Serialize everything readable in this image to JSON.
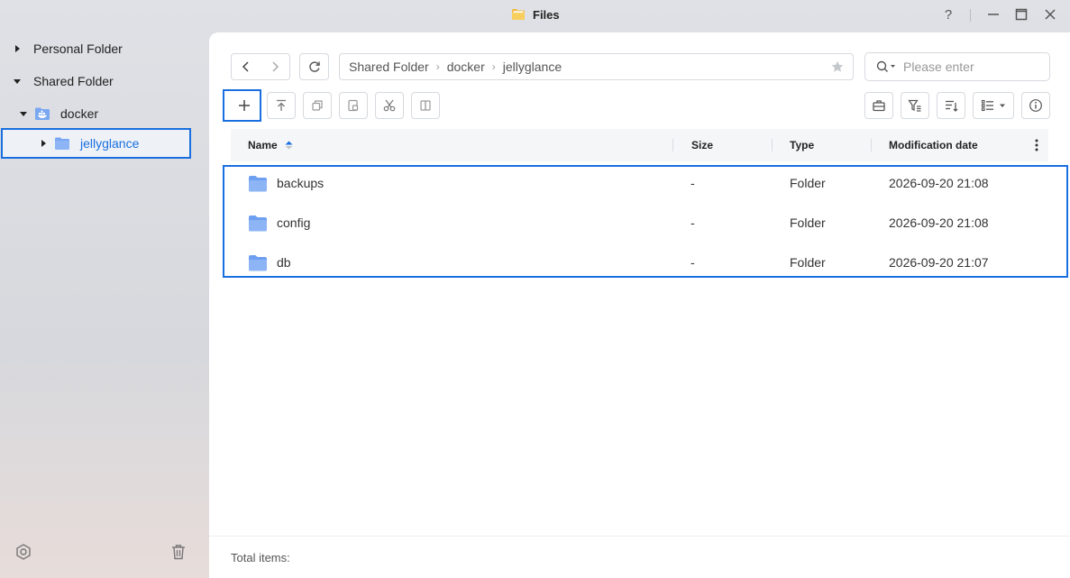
{
  "window": {
    "title": "Files",
    "icon": "folder-app-icon",
    "controls": [
      "help-icon",
      "minimize-icon",
      "maximize-icon",
      "close-icon"
    ],
    "help_label": "?"
  },
  "sidebar": {
    "items": [
      {
        "label": "Personal Folder",
        "expanded": false
      },
      {
        "label": "Shared Folder",
        "expanded": true
      },
      {
        "label": "docker",
        "expanded": true,
        "icon": "docker-folder-icon"
      },
      {
        "label": "jellyglance",
        "expanded": false,
        "selected": true,
        "icon": "folder-icon"
      }
    ],
    "bottom_icons": [
      "settings-icon",
      "trash-icon"
    ]
  },
  "toolbar": {
    "breadcrumb": [
      "Shared Folder",
      "docker",
      "jellyglance"
    ],
    "search_placeholder": "Please enter"
  },
  "table": {
    "columns": {
      "name": "Name",
      "size": "Size",
      "type": "Type",
      "modified": "Modification date"
    },
    "sort": {
      "column": "name",
      "direction": "asc"
    },
    "rows": [
      {
        "name": "backups",
        "size": "-",
        "type": "Folder",
        "modified": "2026-09-20 21:08"
      },
      {
        "name": "config",
        "size": "-",
        "type": "Folder",
        "modified": "2026-09-20 21:08"
      },
      {
        "name": "db",
        "size": "-",
        "type": "Folder",
        "modified": "2026-09-20 21:07"
      }
    ]
  },
  "footer": {
    "total_label": "Total items:"
  },
  "colors": {
    "accent": "#1a6fe0",
    "folder": "#7aa7f2",
    "selected_text": "#1a6fe0"
  }
}
